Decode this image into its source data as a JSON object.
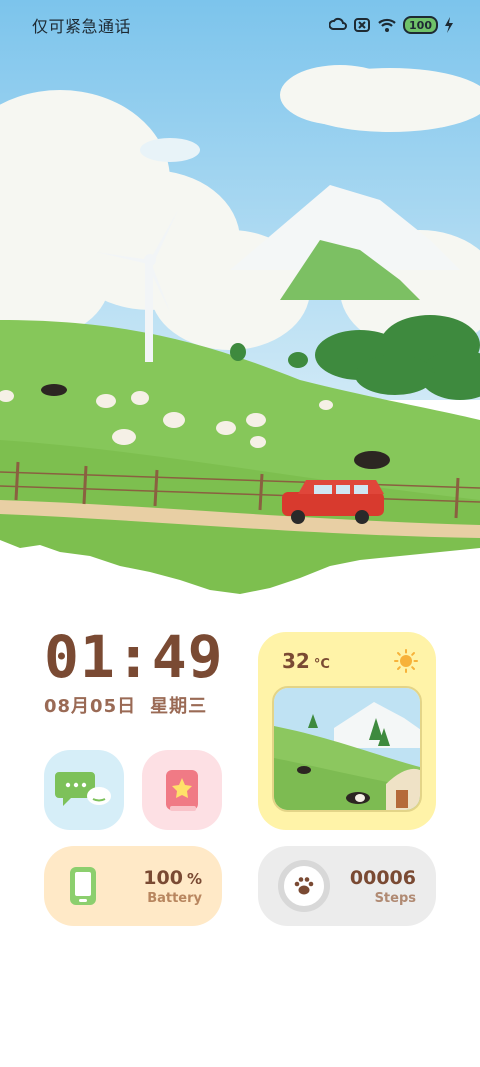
{
  "status_bar": {
    "carrier": "仅可紧急通话",
    "battery_level": "100",
    "icons": [
      "cloud-headset-icon",
      "no-sim-icon",
      "wifi-icon",
      "battery-icon",
      "charging-bolt-icon"
    ]
  },
  "clock": {
    "time": "01:49",
    "date": "08月05日",
    "weekday": "星期三"
  },
  "weather": {
    "temperature": "32",
    "unit": "°C",
    "icon": "sun-icon"
  },
  "apps": [
    {
      "name": "messages",
      "icon": "chat-bubbles-icon"
    },
    {
      "name": "notes",
      "icon": "notebook-flower-icon"
    }
  ],
  "battery_widget": {
    "value": "100",
    "unit": "%",
    "label": "Battery",
    "icon": "phone-icon"
  },
  "steps_widget": {
    "value": "00006",
    "label": "Steps",
    "icon": "paw-icon"
  },
  "colors": {
    "accent_brown": "#7a4a33",
    "weather_bg": "#fff3a8",
    "battery_bg": "#ffe9c7",
    "steps_bg": "#ececec",
    "messages_bg": "#d6eef8",
    "notes_bg": "#fde0e4"
  }
}
